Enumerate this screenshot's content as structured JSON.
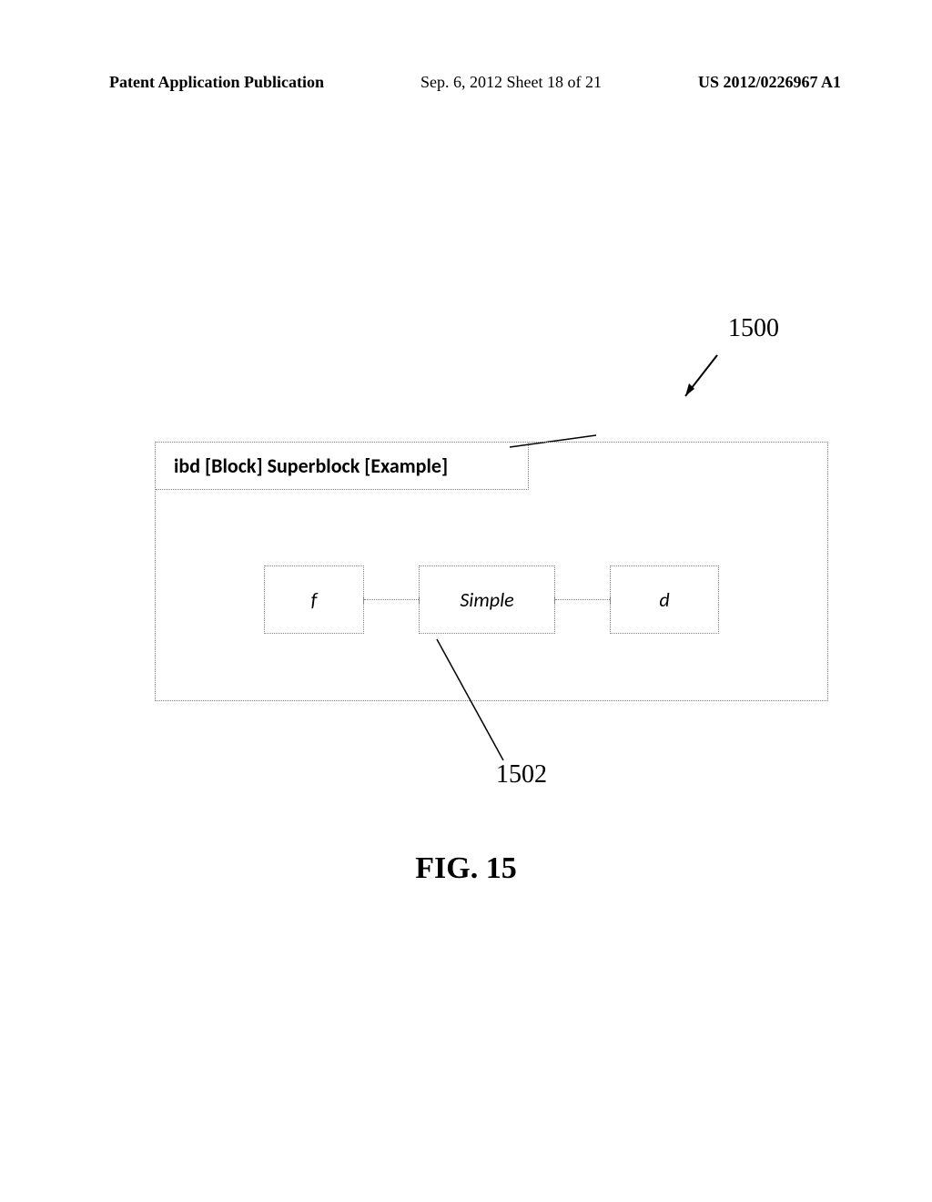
{
  "header": {
    "left": "Patent Application Publication",
    "center": "Sep. 6, 2012  Sheet 18 of 21",
    "right": "US 2012/0226967 A1"
  },
  "refs": {
    "r1500": "1500",
    "r1502": "1502"
  },
  "diagram": {
    "title": "ibd [Block] Superblock [Example]",
    "blocks": {
      "f": "f",
      "simple": "Simple",
      "d": "d"
    }
  },
  "figure_caption": "FIG. 15"
}
